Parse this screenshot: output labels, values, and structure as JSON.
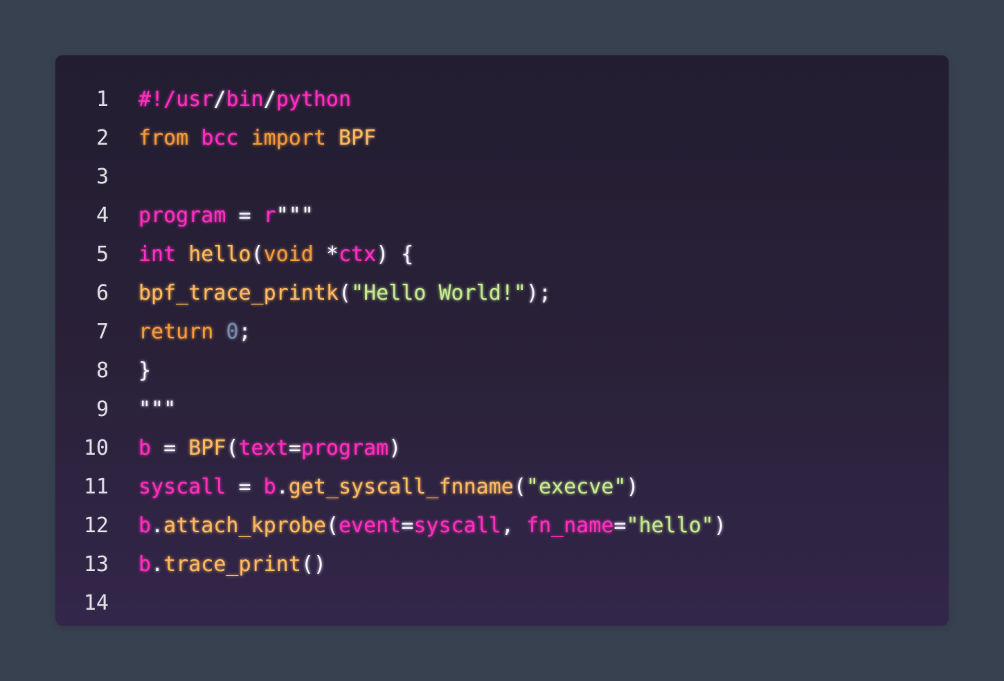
{
  "colors": {
    "page_background": "#38414f",
    "editor_background": "#241f33",
    "line_number": "#dcdbe3",
    "pink": "#ff2ebd",
    "orange": "#f2993a",
    "gold": "#fdb85e",
    "white": "#f4f1ff",
    "green": "#c3e88d",
    "blue": "#7a8aa8"
  },
  "editor": {
    "lines": [
      {
        "number": "1",
        "tokens": [
          {
            "text": "#!/",
            "color": "pink"
          },
          {
            "text": "usr",
            "color": "pink"
          },
          {
            "text": "/",
            "color": "white"
          },
          {
            "text": "bin",
            "color": "pink"
          },
          {
            "text": "/",
            "color": "white"
          },
          {
            "text": "python",
            "color": "pink"
          }
        ]
      },
      {
        "number": "2",
        "tokens": [
          {
            "text": "from",
            "color": "orange"
          },
          {
            "text": " ",
            "color": "white"
          },
          {
            "text": "bcc",
            "color": "pink"
          },
          {
            "text": " ",
            "color": "white"
          },
          {
            "text": "import",
            "color": "orange"
          },
          {
            "text": " ",
            "color": "white"
          },
          {
            "text": "BPF",
            "color": "gold"
          }
        ]
      },
      {
        "number": "3",
        "tokens": []
      },
      {
        "number": "4",
        "tokens": [
          {
            "text": "program",
            "color": "pink"
          },
          {
            "text": " = ",
            "color": "white"
          },
          {
            "text": "r",
            "color": "pink"
          },
          {
            "text": "\"\"\"",
            "color": "white"
          }
        ]
      },
      {
        "number": "5",
        "tokens": [
          {
            "text": "int",
            "color": "pink"
          },
          {
            "text": " ",
            "color": "white"
          },
          {
            "text": "hello",
            "color": "gold"
          },
          {
            "text": "(",
            "color": "white"
          },
          {
            "text": "void",
            "color": "orange"
          },
          {
            "text": " *",
            "color": "white"
          },
          {
            "text": "ctx",
            "color": "pink"
          },
          {
            "text": ") {",
            "color": "white"
          }
        ]
      },
      {
        "number": "6",
        "tokens": [
          {
            "text": "bpf_trace_printk",
            "color": "gold"
          },
          {
            "text": "(",
            "color": "white"
          },
          {
            "text": "\"Hello World!\"",
            "color": "green"
          },
          {
            "text": ");",
            "color": "white"
          }
        ]
      },
      {
        "number": "7",
        "tokens": [
          {
            "text": "return",
            "color": "orange"
          },
          {
            "text": " ",
            "color": "white"
          },
          {
            "text": "0",
            "color": "blue"
          },
          {
            "text": ";",
            "color": "white"
          }
        ]
      },
      {
        "number": "8",
        "tokens": [
          {
            "text": "}",
            "color": "white"
          }
        ]
      },
      {
        "number": "9",
        "tokens": [
          {
            "text": "\"\"\"",
            "color": "white"
          }
        ]
      },
      {
        "number": "10",
        "tokens": [
          {
            "text": "b",
            "color": "pink"
          },
          {
            "text": " = ",
            "color": "white"
          },
          {
            "text": "BPF",
            "color": "gold"
          },
          {
            "text": "(",
            "color": "white"
          },
          {
            "text": "text",
            "color": "pink"
          },
          {
            "text": "=",
            "color": "white"
          },
          {
            "text": "program",
            "color": "pink"
          },
          {
            "text": ")",
            "color": "white"
          }
        ]
      },
      {
        "number": "11",
        "tokens": [
          {
            "text": "syscall",
            "color": "pink"
          },
          {
            "text": " = ",
            "color": "white"
          },
          {
            "text": "b",
            "color": "pink"
          },
          {
            "text": ".",
            "color": "white"
          },
          {
            "text": "get_syscall_fnname",
            "color": "gold"
          },
          {
            "text": "(",
            "color": "white"
          },
          {
            "text": "\"execve\"",
            "color": "green"
          },
          {
            "text": ")",
            "color": "white"
          }
        ]
      },
      {
        "number": "12",
        "tokens": [
          {
            "text": "b",
            "color": "pink"
          },
          {
            "text": ".",
            "color": "white"
          },
          {
            "text": "attach_kprobe",
            "color": "gold"
          },
          {
            "text": "(",
            "color": "white"
          },
          {
            "text": "event",
            "color": "pink"
          },
          {
            "text": "=",
            "color": "white"
          },
          {
            "text": "syscall",
            "color": "pink"
          },
          {
            "text": ", ",
            "color": "white"
          },
          {
            "text": "fn_name",
            "color": "pink"
          },
          {
            "text": "=",
            "color": "white"
          },
          {
            "text": "\"hello\"",
            "color": "green"
          },
          {
            "text": ")",
            "color": "white"
          }
        ]
      },
      {
        "number": "13",
        "tokens": [
          {
            "text": "b",
            "color": "pink"
          },
          {
            "text": ".",
            "color": "white"
          },
          {
            "text": "trace_print",
            "color": "gold"
          },
          {
            "text": "()",
            "color": "white"
          }
        ]
      },
      {
        "number": "14",
        "tokens": []
      }
    ]
  }
}
